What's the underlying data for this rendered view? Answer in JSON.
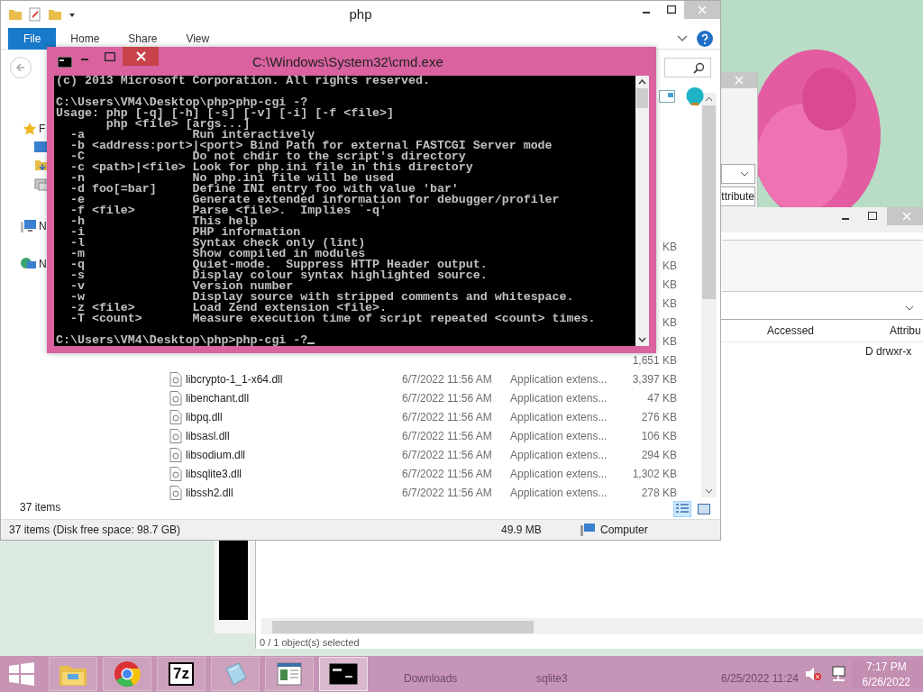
{
  "explorer": {
    "title": "php",
    "ribbon_tabs": [
      {
        "label": "File",
        "selected": true
      },
      {
        "label": "Home",
        "selected": false
      },
      {
        "label": "Share",
        "selected": false
      },
      {
        "label": "View",
        "selected": false
      }
    ],
    "nav_items": [
      {
        "kind": "favorites",
        "label": "F"
      },
      {
        "kind": "computer",
        "label": "N"
      },
      {
        "kind": "network",
        "label": "N"
      }
    ],
    "rows": [
      {
        "size": "KB"
      },
      {
        "size": "KB"
      },
      {
        "size": "KB"
      },
      {
        "size": "KB"
      },
      {
        "size": "KB"
      },
      {
        "size": "KB"
      },
      {
        "size": "1,651 KB"
      },
      {
        "name": "libcrypto-1_1-x64.dll",
        "date": "6/7/2022 11:56 AM",
        "type": "Application extens...",
        "size": "3,397 KB"
      },
      {
        "name": "libenchant.dll",
        "date": "6/7/2022 11:56 AM",
        "type": "Application extens...",
        "size": "47 KB"
      },
      {
        "name": "libpq.dll",
        "date": "6/7/2022 11:56 AM",
        "type": "Application extens...",
        "size": "276 KB"
      },
      {
        "name": "libsasl.dll",
        "date": "6/7/2022 11:56 AM",
        "type": "Application extens...",
        "size": "106 KB"
      },
      {
        "name": "libsodium.dll",
        "date": "6/7/2022 11:56 AM",
        "type": "Application extens...",
        "size": "294 KB"
      },
      {
        "name": "libsqlite3.dll",
        "date": "6/7/2022 11:56 AM",
        "type": "Application extens...",
        "size": "1,302 KB"
      },
      {
        "name": "libssh2.dll",
        "date": "6/7/2022 11:56 AM",
        "type": "Application extens...",
        "size": "278 KB"
      }
    ],
    "item_count": "37 items",
    "status": {
      "summary": "37 items (Disk free space: 98.7 GB)",
      "size": "49.9 MB",
      "location": "Computer"
    }
  },
  "console": {
    "title": "C:\\Windows\\System32\\cmd.exe",
    "lines": [
      {
        "text": "(c) 2013 Microsoft Corporation. All rights reserved."
      },
      {
        "text": "C:\\Users\\VM4\\Desktop\\php>php-cgi -?",
        "blank_before": true
      },
      {
        "text": "Usage: php [-q] [-h] [-s] [-v] [-i] [-f <file>]"
      },
      {
        "text": "       php <file> [args...]"
      },
      {
        "text": "  -a               Run interactively"
      },
      {
        "text": "  -b <address:port>|<port> Bind Path for external FASTCGI Server mode"
      },
      {
        "text": "  -C               Do not chdir to the script's directory"
      },
      {
        "text": "  -c <path>|<file> Look for php.ini file in this directory"
      },
      {
        "text": "  -n               No php.ini file will be used"
      },
      {
        "text": "  -d foo[=bar]     Define INI entry foo with value 'bar'"
      },
      {
        "text": "  -e               Generate extended information for debugger/profiler"
      },
      {
        "text": "  -f <file>        Parse <file>.  Implies `-q'"
      },
      {
        "text": "  -h               This help"
      },
      {
        "text": "  -i               PHP information"
      },
      {
        "text": "  -l               Syntax check only (lint)"
      },
      {
        "text": "  -m               Show compiled in modules"
      },
      {
        "text": "  -q               Quiet-mode.  Suppress HTTP Header output."
      },
      {
        "text": "  -s               Display colour syntax highlighted source."
      },
      {
        "text": "  -v               Version number"
      },
      {
        "text": "  -w               Display source with stripped comments and whitespace."
      },
      {
        "text": "  -z <file>        Load Zend extension <file>."
      },
      {
        "text": "  -T <count>       Measure execution time of script repeated <count> times."
      },
      {
        "text": "C:\\Users\\VM4\\Desktop\\php>php-cgi -?",
        "blank_before": true,
        "cursor": true
      }
    ]
  },
  "back_window": {
    "header_fragment": "ttribute"
  },
  "details_window": {
    "columns": [
      "Accessed",
      "Attribu"
    ],
    "cell": "D drwxr-x",
    "status": "0 / 1 object(s) selected"
  },
  "taskbar": {
    "behind": [
      "Downloads",
      "sqlite3",
      "6/25/2022 11:24"
    ],
    "buttons": [
      {
        "kind": "explorer",
        "selected": false
      },
      {
        "kind": "chrome",
        "selected": false
      },
      {
        "kind": "archiver",
        "label": "7z",
        "selected": false
      },
      {
        "kind": "notepad",
        "selected": false
      },
      {
        "kind": "document",
        "selected": false
      },
      {
        "kind": "console",
        "selected": true
      }
    ],
    "time": "7:17 PM",
    "date": "6/26/2022"
  }
}
